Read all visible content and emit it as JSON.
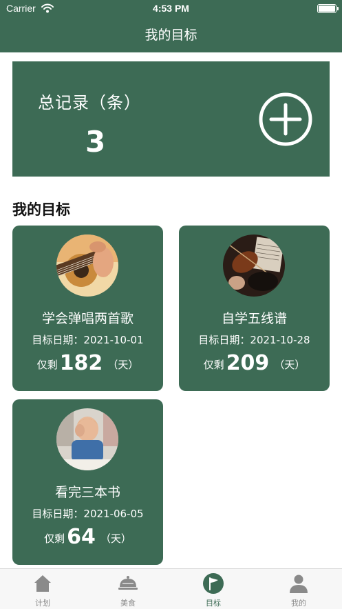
{
  "status_bar": {
    "carrier": "Carrier",
    "time": "4:53 PM"
  },
  "nav": {
    "title": "我的目标"
  },
  "summary": {
    "label": "总记录（条）",
    "count": "3"
  },
  "section": {
    "title": "我的目标"
  },
  "goals": [
    {
      "name": "学会弹唱两首歌",
      "date_prefix": "目标日期：",
      "date": "2021-10-01",
      "remain_prefix": "仅剩",
      "days": "182",
      "unit": "（天）",
      "image": "guitar-photo"
    },
    {
      "name": "自学五线谱",
      "date_prefix": "目标日期：",
      "date": "2021-10-28",
      "remain_prefix": "仅剩",
      "days": "209",
      "unit": "（天）",
      "image": "violin-sheet-music-photo"
    },
    {
      "name": "看完三本书",
      "date_prefix": "目标日期：",
      "date": "2021-06-05",
      "remain_prefix": "仅剩",
      "days": "64",
      "unit": "（天）",
      "image": "child-studying-photo"
    }
  ],
  "tabs": [
    {
      "label": "计划",
      "icon": "home-icon"
    },
    {
      "label": "美食",
      "icon": "cloche-icon"
    },
    {
      "label": "目标",
      "icon": "flag-icon",
      "active": true
    },
    {
      "label": "我的",
      "icon": "person-icon"
    }
  ],
  "colors": {
    "primary": "#3d6b55",
    "tab_inactive": "#8a8a8a",
    "tab_bar_bg": "#f7f7f7"
  }
}
